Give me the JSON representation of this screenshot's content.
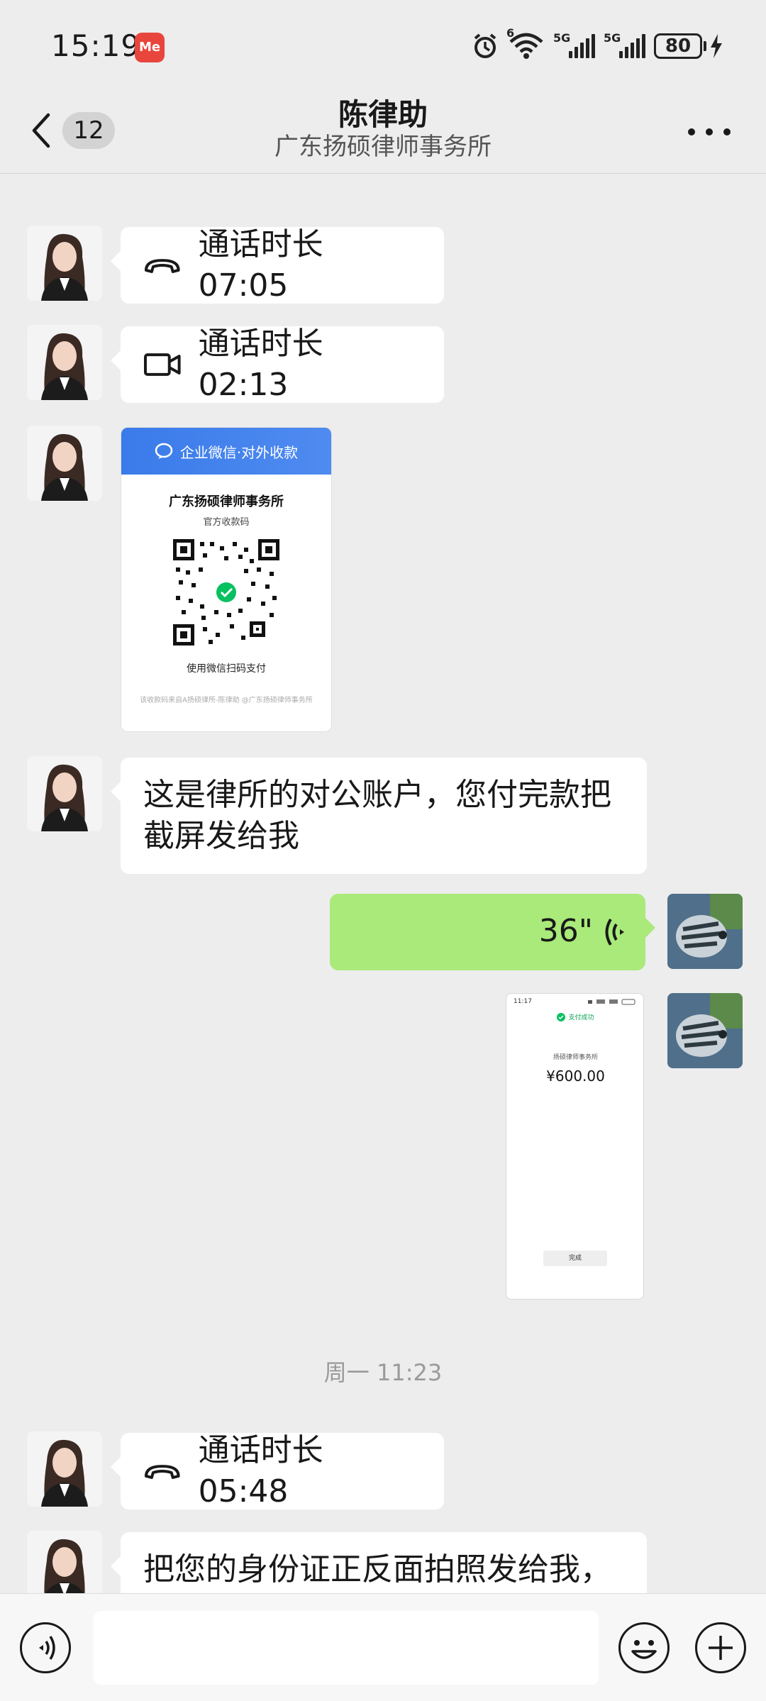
{
  "status_bar": {
    "time": "15:19",
    "app_badge": "Me",
    "sig1_label": "5G",
    "sig2_label": "5G",
    "wifi_label": "6",
    "battery": "80"
  },
  "header": {
    "unread_count": "12",
    "title": "陈律助",
    "subtitle": "广东扬硕律师事务所"
  },
  "messages": {
    "call1": "通话时长 07:05",
    "call2": "通话时长 02:13",
    "qr": {
      "header": "企业微信·对外收款",
      "org": "广东扬硕律师事务所",
      "sub": "官方收款码",
      "hint": "使用微信扫码支付",
      "foot": "该收款码来自A扬硕律所-陈律助 @广东扬硕律师事务所"
    },
    "text1": "这是律所的对公账户，您付完款把截屏发给我",
    "voice_duration": "36\"",
    "receipt": {
      "time": "11:17",
      "status": "支付成功",
      "merchant": "扬硕律师事务所",
      "amount": "¥600.00",
      "done": "完成"
    },
    "timestamp2": "周一 11:23",
    "call3": "通话时长 05:48",
    "text2": "把您的身份证正反面拍照发给我，"
  },
  "colors": {
    "background": "#ededed",
    "bubble_in": "#ffffff",
    "bubble_out": "#a9ea7a",
    "qr_header": "#3a7bea"
  },
  "icons": {
    "back": "chevron-left-icon",
    "more": "more-dots-icon",
    "voice_call": "phone-hangup-icon",
    "video_call": "video-camera-icon",
    "voice_msg": "voice-wave-icon",
    "voice_input": "voice-input-icon",
    "emoji": "emoji-icon",
    "plus": "plus-icon"
  }
}
